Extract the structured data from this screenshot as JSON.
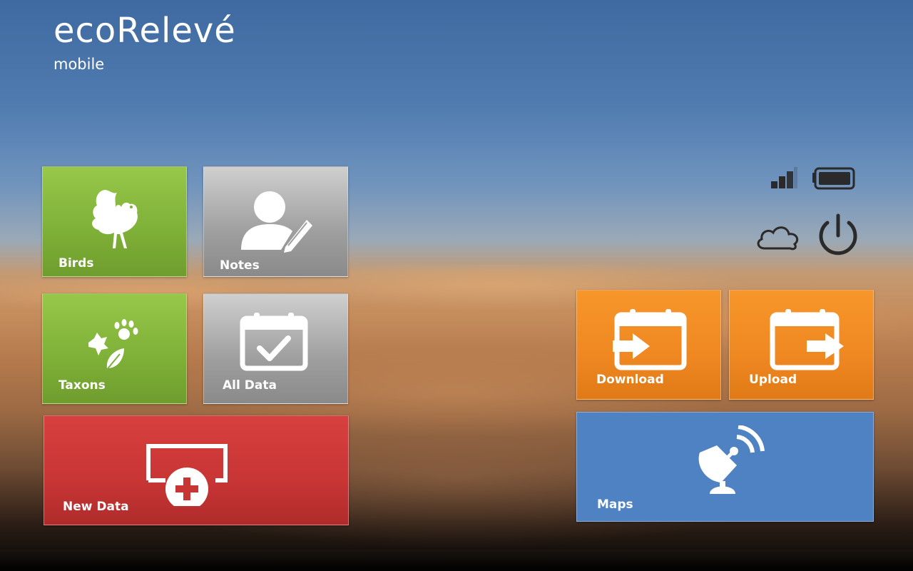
{
  "app": {
    "title": "ecoRelevé",
    "subtitle": "mobile"
  },
  "tiles": {
    "birds": {
      "label": "Birds",
      "icon": "bird-icon"
    },
    "notes": {
      "label": "Notes",
      "icon": "user-edit-icon"
    },
    "taxons": {
      "label": "Taxons",
      "icon": "paw-leaf-icon"
    },
    "all_data": {
      "label": "All Data",
      "icon": "calendar-check-icon"
    },
    "new_data": {
      "label": "New Data",
      "icon": "add-screen-icon"
    },
    "download": {
      "label": "Download",
      "icon": "calendar-import-icon"
    },
    "upload": {
      "label": "Upload",
      "icon": "calendar-export-icon"
    },
    "maps": {
      "label": "Maps",
      "icon": "satellite-dish-icon"
    }
  },
  "status": {
    "signal_icon": "signal-icon",
    "battery_icon": "battery-icon",
    "cloud_icon": "cloud-icon",
    "power_icon": "power-icon"
  },
  "colors": {
    "green": "#7eaf37",
    "grey": "#9e9e9e",
    "red": "#c83535",
    "orange": "#ef8821",
    "blue": "#4f82c2"
  }
}
